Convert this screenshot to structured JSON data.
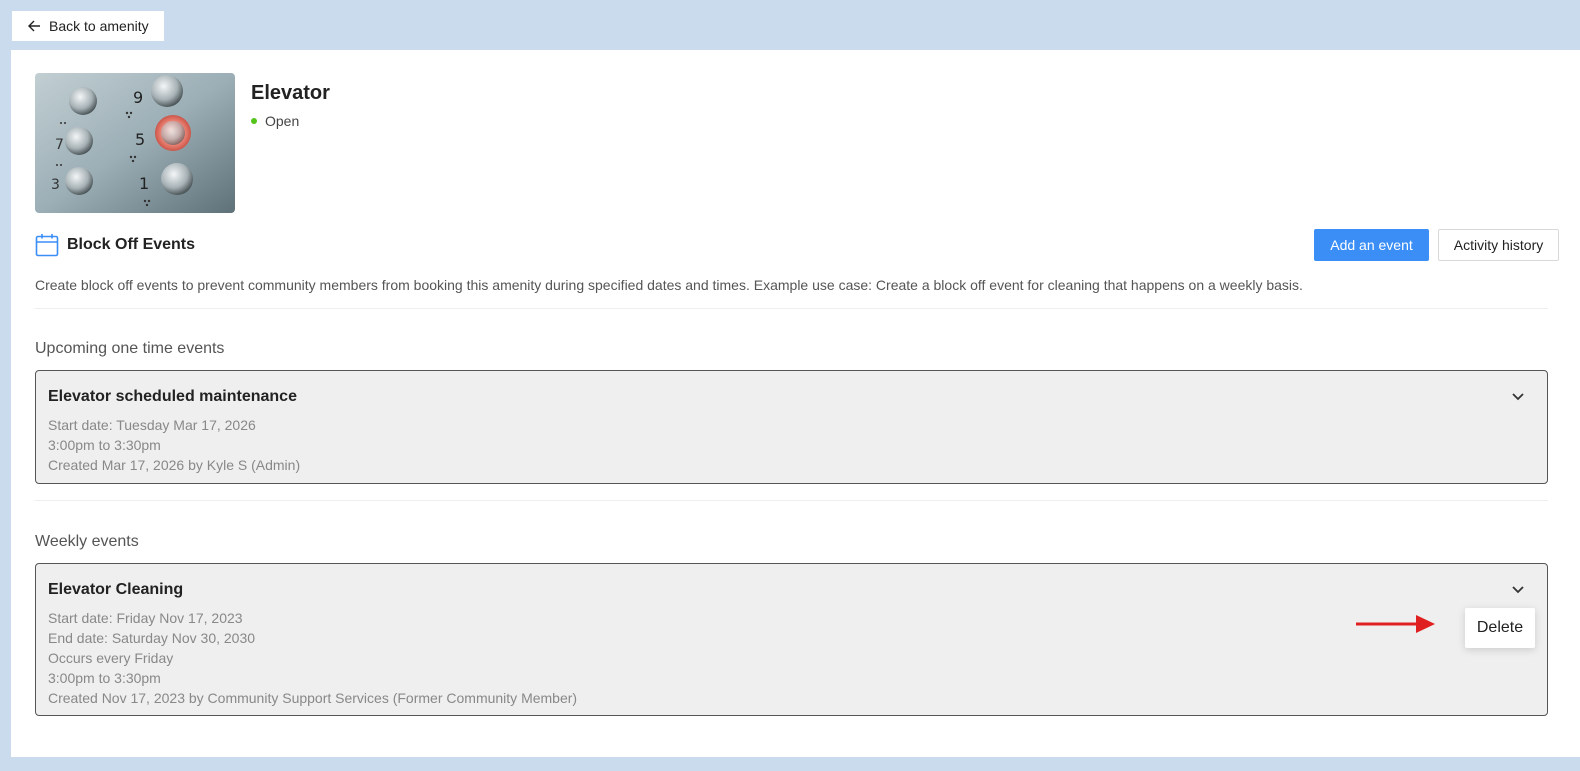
{
  "nav": {
    "back_label": "Back to amenity",
    "back_icon": "arrow-left-icon"
  },
  "amenity": {
    "title": "Elevator",
    "status": "Open",
    "status_color": "#52c41a",
    "image_icon": "elevator-buttons-photo"
  },
  "block_off": {
    "icon": "calendar-icon",
    "title": "Block Off Events",
    "add_label": "Add an event",
    "history_label": "Activity history",
    "description": "Create block off events to prevent community members from booking this amenity during specified dates and times. Example use case: Create a block off event for cleaning that happens on a weekly basis.",
    "accent_color": "#3a8ef6"
  },
  "one_time": {
    "heading": "Upcoming one time events",
    "event": {
      "title": "Elevator scheduled maintenance",
      "lines": [
        "Start date: Tuesday Mar 17, 2026",
        "3:00pm to 3:30pm",
        "Created Mar 17, 2026 by Kyle S (Admin)"
      ]
    }
  },
  "weekly": {
    "heading": "Weekly events",
    "event": {
      "title": "Elevator Cleaning",
      "lines": [
        "Start date: Friday Nov 17, 2023",
        "End date: Saturday Nov 30, 2030",
        "Occurs every Friday",
        "3:00pm to 3:30pm",
        "Created Nov 17, 2023 by Community Support Services (Former Community Member)"
      ]
    },
    "delete_label": "Delete",
    "annotation_color": "#e02020"
  }
}
